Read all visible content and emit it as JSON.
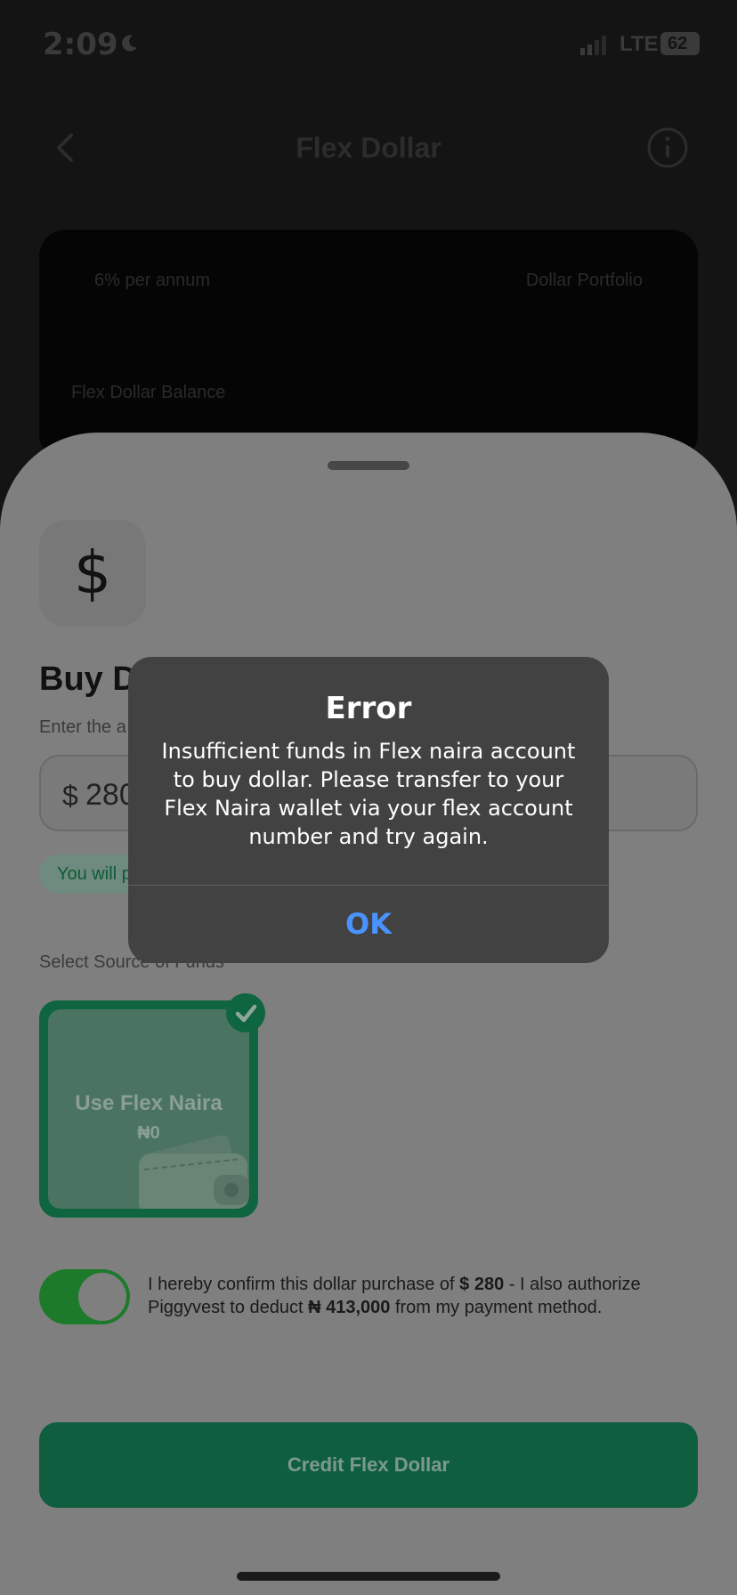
{
  "status_bar": {
    "time": "2:09",
    "network": "LTE",
    "battery": "62"
  },
  "header": {
    "title": "Flex Dollar"
  },
  "balance_card": {
    "rate": "6% per annum",
    "portfolio_link": "Dollar Portfolio",
    "balance_label": "Flex Dollar Balance"
  },
  "sheet": {
    "heading": "Buy D",
    "amount_caption": "Enter the a",
    "currency_symbol": "$",
    "amount_value": "280",
    "you_will_pay": "You will p",
    "source_label": "Select Source of Funds",
    "source_card": {
      "name": "Use Flex Naira",
      "balance": "₦0",
      "selected": true
    },
    "confirm": {
      "part1": "I hereby confirm this dollar purchase of ",
      "amount": "$ 280",
      "part2": " - I also authorize Piggyvest to deduct ",
      "naira": "₦ 413,000",
      "part3": " from my payment method.",
      "toggle_on": true
    },
    "credit_button": "Credit Flex Dollar"
  },
  "alert": {
    "title": "Error",
    "message": "Insufficient funds in Flex naira account to buy dollar. Please transfer to your Flex Naira wallet via your flex account number and try again.",
    "ok_label": "OK"
  },
  "colors": {
    "brand_green": "#0e6540",
    "toggle_green": "#1d7a2a",
    "alert_link": "#4a93ff"
  }
}
